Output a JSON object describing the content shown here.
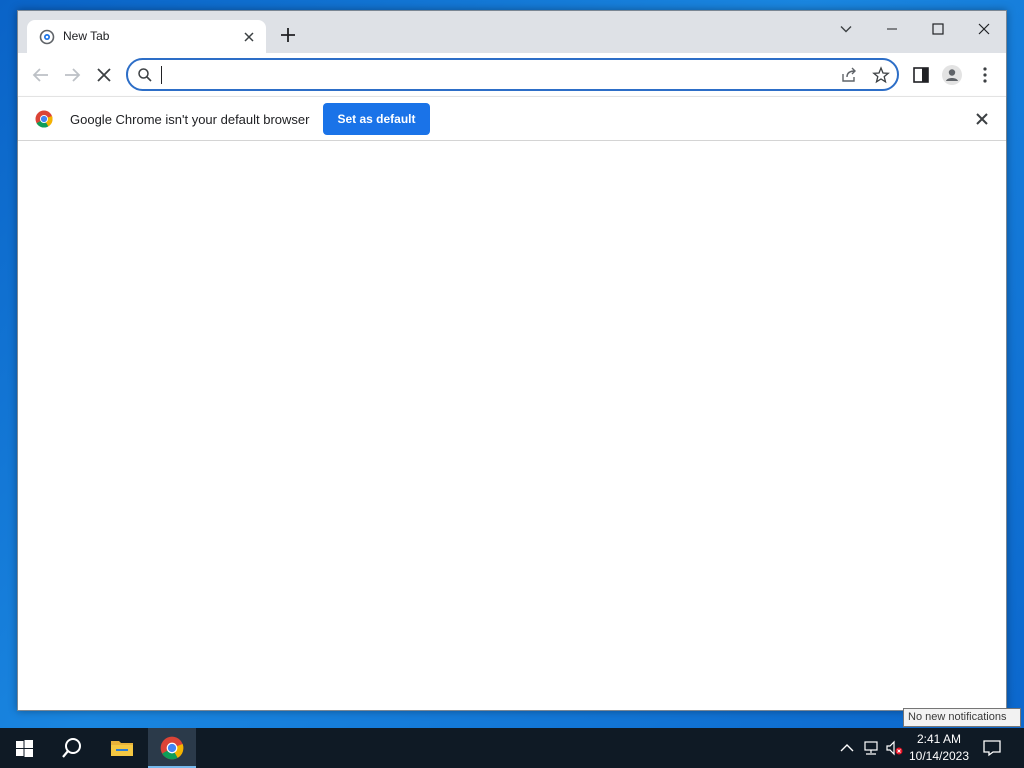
{
  "window": {
    "tab": {
      "title": "New Tab"
    },
    "omnibox": {
      "value": "",
      "placeholder": ""
    },
    "infobar": {
      "message": "Google Chrome isn't your default browser",
      "button_label": "Set as default"
    }
  },
  "tooltip": {
    "text": "No new notifications"
  },
  "taskbar": {
    "clock": {
      "time": "2:41 AM",
      "date": "10/14/2023"
    }
  },
  "colors": {
    "accent": "#1a73e8",
    "omnibox_border": "#2d6ec7",
    "titlebar": "#dee1e6",
    "taskbar": "#0f1a25"
  },
  "icons": [
    "new-tab-favicon-icon",
    "close-icon",
    "plus-icon",
    "chevron-down-icon",
    "minimize-icon",
    "maximize-icon",
    "back-arrow-icon",
    "forward-arrow-icon",
    "stop-loading-icon",
    "search-icon",
    "share-icon",
    "star-icon",
    "side-panel-icon",
    "profile-icon",
    "more-menu-icon",
    "chrome-logo-icon",
    "windows-start-icon",
    "file-explorer-icon",
    "network-icon",
    "volume-muted-icon",
    "notification-icon"
  ]
}
